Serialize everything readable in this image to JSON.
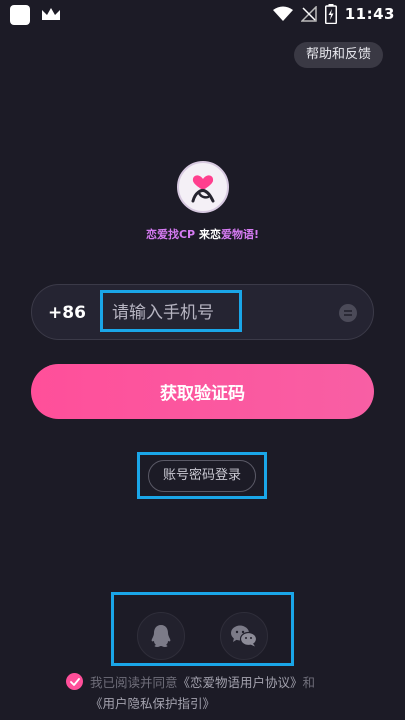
{
  "status_bar": {
    "time": "11:43",
    "icons": [
      "app-square-icon",
      "crown-icon",
      "wifi-icon",
      "no-signal-icon",
      "battery-charging-icon"
    ]
  },
  "header": {
    "help_label": "帮助和反馈"
  },
  "brand": {
    "slogan_part1": "恋爱找CP",
    "slogan_part2": "来恋",
    "slogan_part3": "爱物语!"
  },
  "phone": {
    "country_code": "+86",
    "placeholder": "请输入手机号",
    "value": ""
  },
  "actions": {
    "get_code_label": "获取验证码",
    "account_login_label": "账号密码登录"
  },
  "social": {
    "items": [
      "qq-icon",
      "wechat-icon"
    ]
  },
  "agreement": {
    "prefix": "我已阅读并同意",
    "user_agreement": "《恋爱物语用户协议》",
    "conjunction": "和",
    "privacy_guide": "《用户隐私保护指引》"
  },
  "colors": {
    "background": "#1c1b26",
    "accent": "#ff4f9a",
    "highlight": "#1aa6e8"
  }
}
